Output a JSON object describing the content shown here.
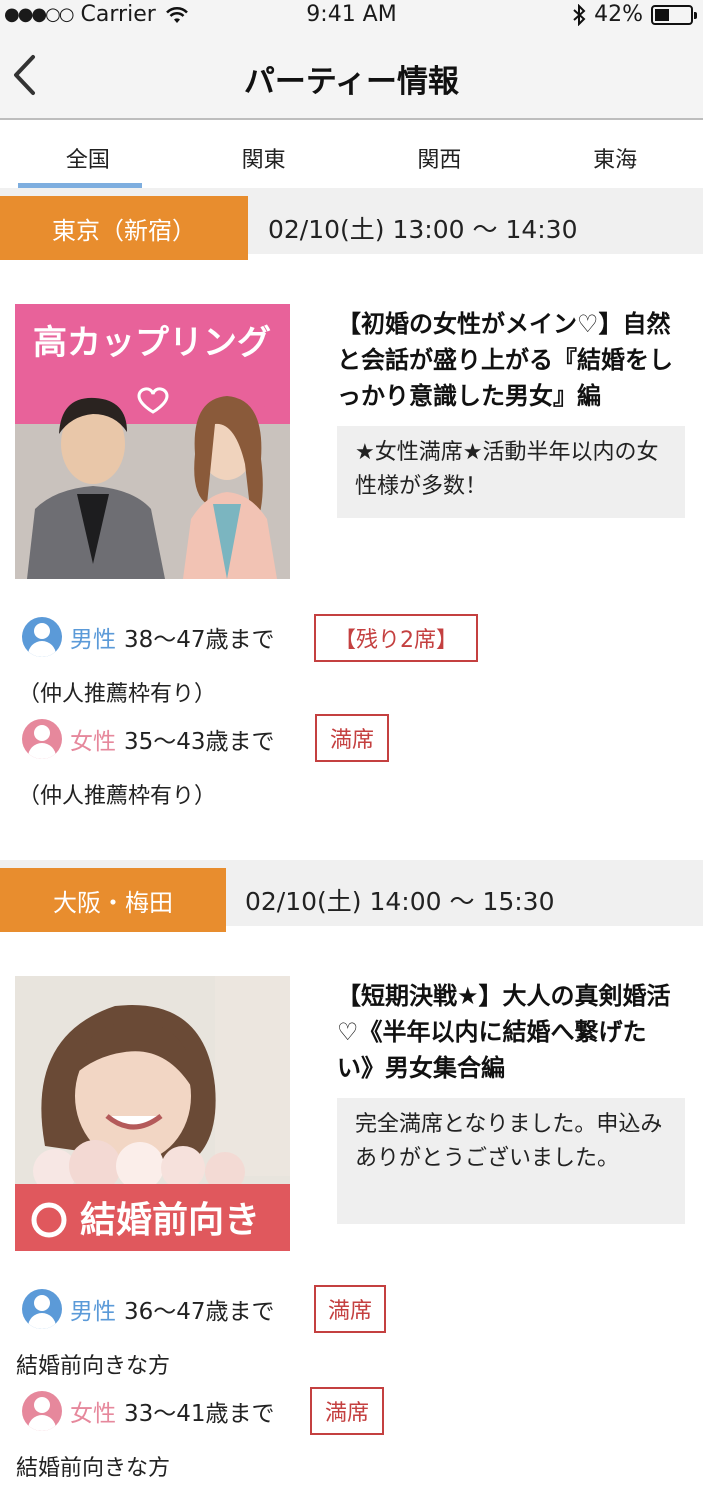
{
  "status_bar": {
    "carrier": "Carrier",
    "time": "9:41 AM",
    "battery": "42%",
    "battery_level": 0.42
  },
  "navbar": {
    "back_icon": "chevron-left-icon",
    "title": "パーティー情報"
  },
  "tabs": [
    {
      "label": "全国",
      "active": true
    },
    {
      "label": "関東",
      "active": false
    },
    {
      "label": "関西",
      "active": false
    },
    {
      "label": "東海",
      "active": false
    }
  ],
  "events": [
    {
      "location": "東京（新宿）",
      "datetime": "02/10(土) 13:00 〜 14:30",
      "image_text": "高カップリング",
      "title": "【初婚の女性がメイン♡】自然と会話が盛り上がる『結婚をしっかり意識した男女』編",
      "note": "★女性満席★活動半年以内の女性様が多数！",
      "male": {
        "label": "男性",
        "age": "38〜47歳まで",
        "seat": "【残り2席】",
        "sub": "（仲人推薦枠有り）"
      },
      "female": {
        "label": "女性",
        "age": "35〜43歳まで",
        "seat": "満席",
        "sub": "（仲人推薦枠有り）"
      }
    },
    {
      "location": "大阪・梅田",
      "datetime": "02/10(土) 14:00 〜 15:30",
      "image_text": "結婚前向き",
      "title": "【短期決戦★】大人の真剣婚活♡《半年以内に結婚へ繋げたい》男女集合編",
      "note": "完全満席となりました。申込みありがとうございました。",
      "male": {
        "label": "男性",
        "age": "36〜47歳まで",
        "seat": "満席",
        "sub": "結婚前向きな方"
      },
      "female": {
        "label": "女性",
        "age": "33〜41歳まで",
        "seat": "満席",
        "sub": "結婚前向きな方"
      }
    }
  ],
  "colors": {
    "accent_orange": "#e88d2e",
    "tab_indicator": "#7eaedf",
    "male": "#5b9ad8",
    "female": "#e6889c",
    "seat_red": "#c44040"
  }
}
